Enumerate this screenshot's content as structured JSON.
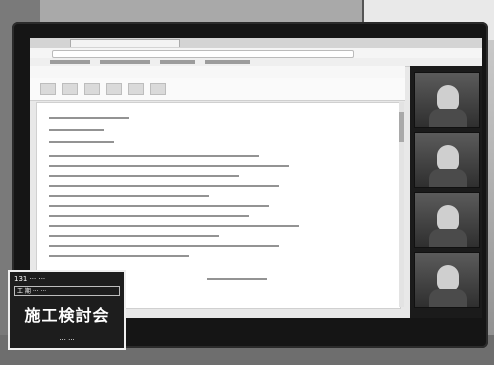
{
  "scene": {
    "type": "photo",
    "subject": "monitor-with-video-conference-and-document",
    "dominant_colors": {
      "monitor_bezel": "#151515",
      "screen_bg": "#e8e8e8",
      "document_bg": "#ffffff"
    }
  },
  "browser": {
    "tab_label": ""
  },
  "sign": {
    "header": "131 ··· ···",
    "row": "工 期 ··· ···",
    "main": "施工検討会",
    "footer": "··· ···"
  }
}
